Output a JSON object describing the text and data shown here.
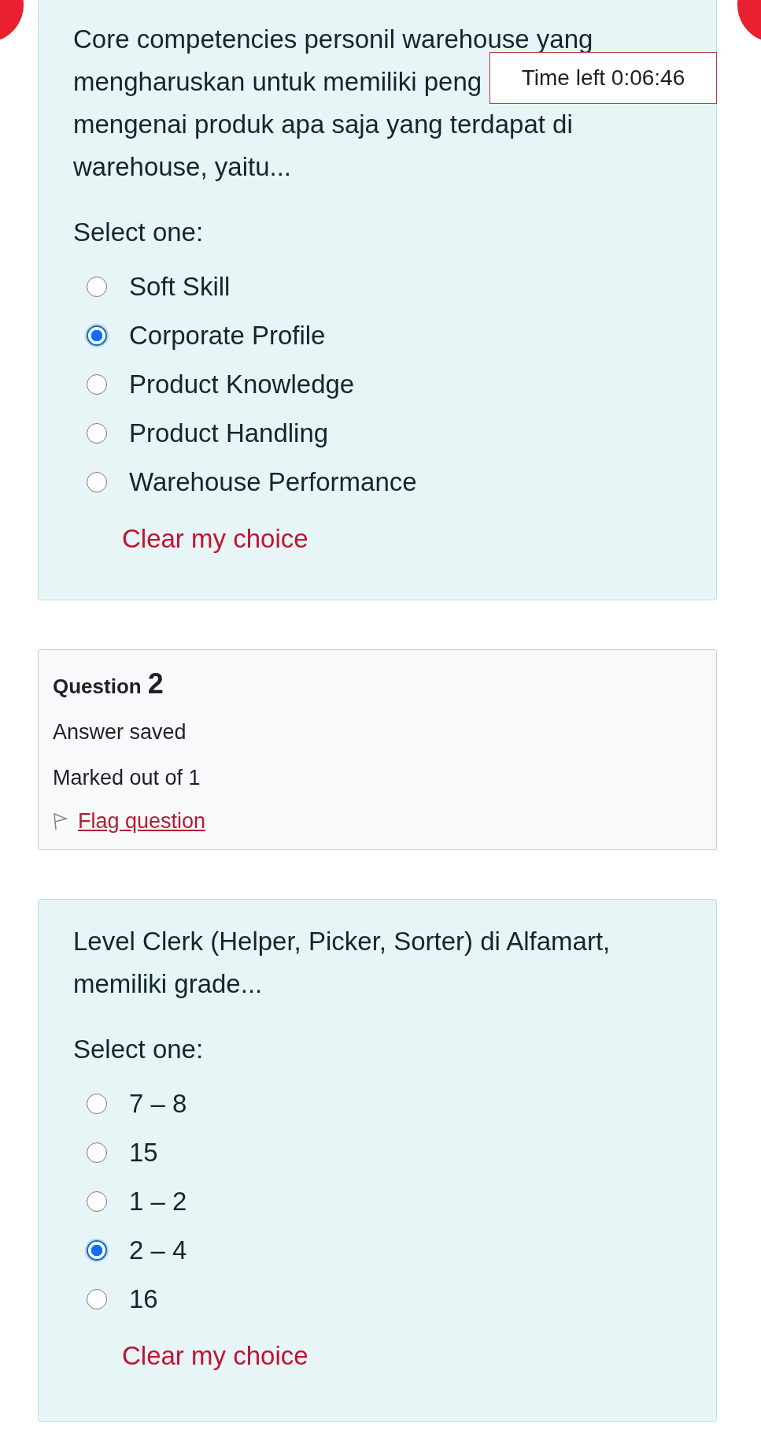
{
  "timer": {
    "label": "Time left 0:06:46"
  },
  "question_1": {
    "text_lines": [
      "Core competencies personil warehouse yang",
      "mengharuskan untuk memiliki peng",
      "mengenai produk apa saja yang terdapat di",
      "warehouse, yaitu..."
    ],
    "prompt": "Select one:",
    "options": [
      {
        "label": "Soft Skill",
        "selected": false
      },
      {
        "label": "Corporate Profile",
        "selected": true
      },
      {
        "label": "Product Knowledge",
        "selected": false
      },
      {
        "label": "Product Handling",
        "selected": false
      },
      {
        "label": "Warehouse Performance",
        "selected": false
      }
    ],
    "clear_link": "Clear my choice"
  },
  "question_2_info": {
    "label": "Question",
    "number": "2",
    "status": "Answer saved",
    "marks": "Marked out of 1",
    "flag_link": "Flag question"
  },
  "question_2": {
    "text_lines": [
      "Level Clerk (Helper, Picker, Sorter) di Alfamart,",
      "memiliki grade..."
    ],
    "prompt": "Select one:",
    "options": [
      {
        "label": "7 – 8",
        "selected": false
      },
      {
        "label": "15",
        "selected": false
      },
      {
        "label": "1 – 2",
        "selected": false
      },
      {
        "label": "2 – 4",
        "selected": true
      },
      {
        "label": "16",
        "selected": false
      }
    ],
    "clear_link": "Clear my choice"
  }
}
